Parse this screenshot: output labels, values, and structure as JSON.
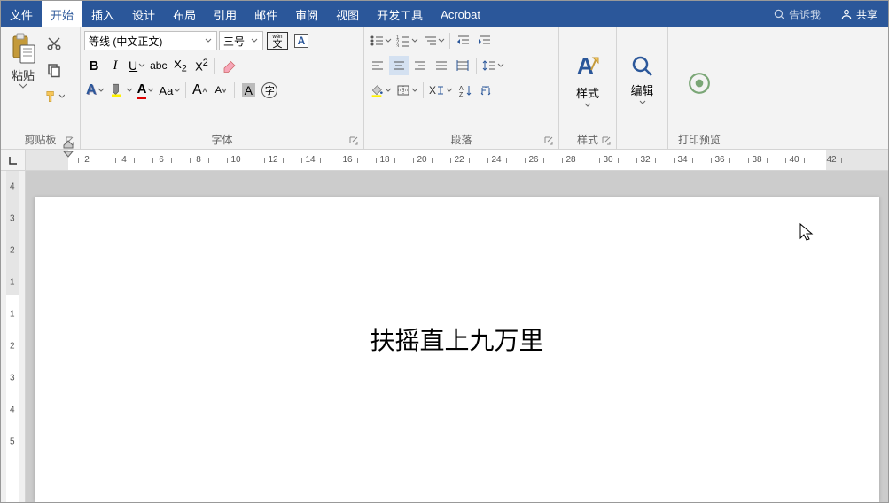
{
  "menu": {
    "items": [
      "文件",
      "开始",
      "插入",
      "设计",
      "布局",
      "引用",
      "邮件",
      "审阅",
      "视图",
      "开发工具",
      "Acrobat"
    ],
    "active_index": 1,
    "tell_me": "告诉我",
    "share": "共享"
  },
  "ribbon": {
    "clipboard": {
      "label": "剪贴板",
      "paste": "粘贴"
    },
    "font": {
      "label": "字体",
      "name": "等线 (中文正文)",
      "size": "三号",
      "wen_pinyin": "wén",
      "wen_char": "文",
      "border_char": "A",
      "bold": "B",
      "italic": "I",
      "underline": "U",
      "strike": "abc",
      "sub": "X",
      "sub2": "2",
      "sup": "X",
      "sup2": "2",
      "texteffect": "A",
      "highlight": "ab",
      "fontcolor": "A",
      "changecase": "Aa",
      "grow": "A",
      "shrink": "A",
      "charbg": "A",
      "enclosed": "字"
    },
    "paragraph": {
      "label": "段落"
    },
    "styles": {
      "label": "样式",
      "btn": "样式"
    },
    "edit": {
      "label": "编辑",
      "btn": "编辑"
    },
    "preview": {
      "label": "打印预览"
    }
  },
  "ruler": {
    "h_numbers": [
      2,
      4,
      6,
      8,
      10,
      12,
      14,
      16,
      18,
      20,
      22,
      24,
      26,
      28,
      30,
      32,
      34,
      36,
      38,
      40,
      42
    ],
    "v_numbers": [
      4,
      3,
      2,
      1,
      1,
      2,
      3,
      4,
      5
    ]
  },
  "document": {
    "text": "扶摇直上九万里"
  }
}
